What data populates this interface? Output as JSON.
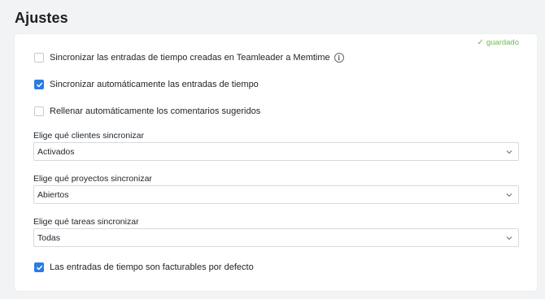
{
  "page": {
    "title": "Ajustes"
  },
  "status": {
    "saved_label": "guardado",
    "color": "#6dbb4b"
  },
  "options": {
    "sync_created": {
      "label": "Sincronizar las entradas de tiempo creadas en Teamleader a Memtime",
      "checked": false
    },
    "auto_sync": {
      "label": "Sincronizar automáticamente las entradas de tiempo",
      "checked": true
    },
    "autofill_comments": {
      "label": "Rellenar automáticamente los comentarios sugeridos",
      "checked": false
    },
    "billable_default": {
      "label": "Las entradas de tiempo son facturables por defecto",
      "checked": true
    }
  },
  "selects": {
    "clients": {
      "label": "Elige qué clientes sincronizar",
      "value": "Activados"
    },
    "projects": {
      "label": "Elige qué proyectos sincronizar",
      "value": "Abiertos"
    },
    "tasks": {
      "label": "Elige qué tareas sincronizar",
      "value": "Todas"
    }
  },
  "accent": "#2c7be5"
}
